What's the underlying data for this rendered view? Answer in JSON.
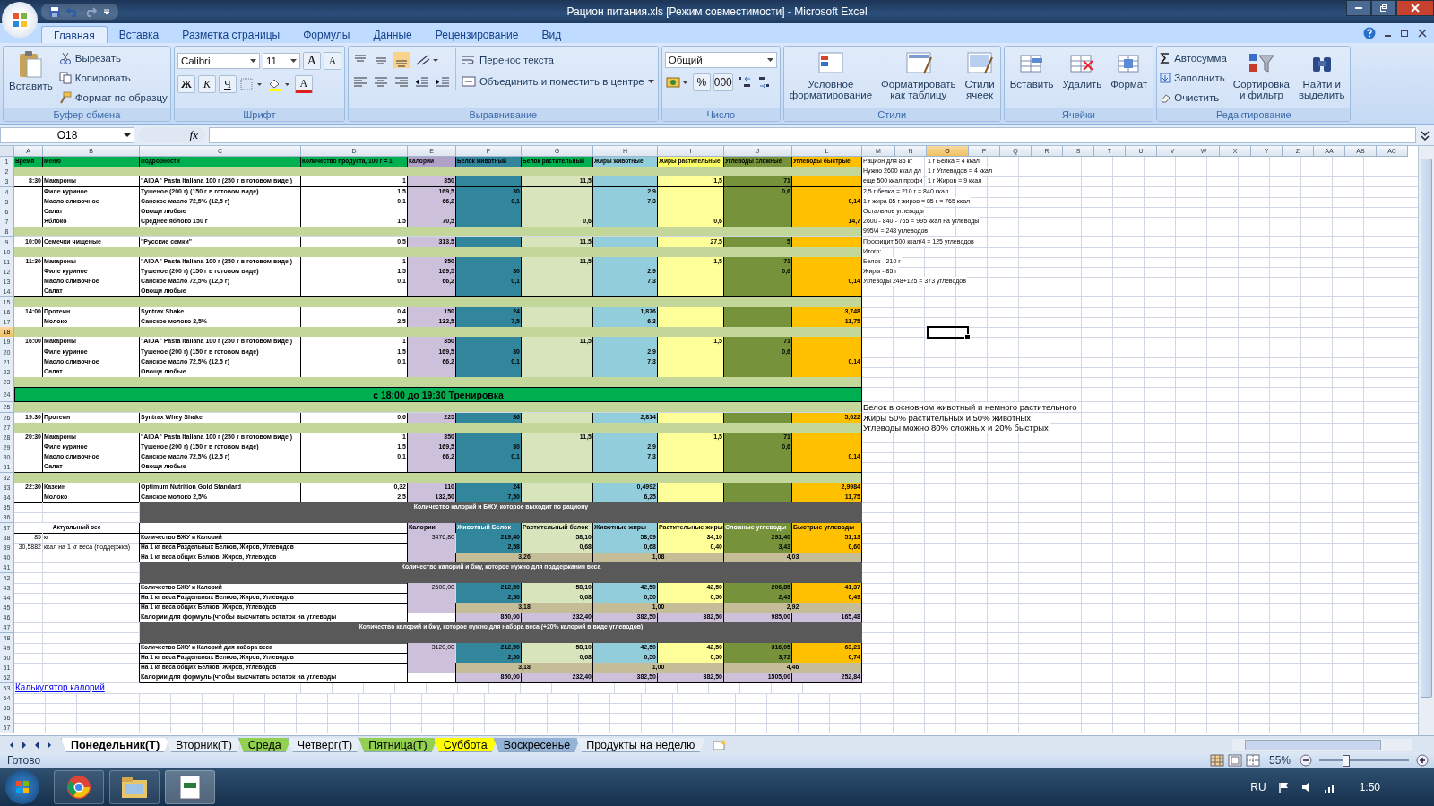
{
  "window": {
    "title": "Рацион питания.xls  [Режим совместимости] - Microsoft Excel"
  },
  "ribbon": {
    "tabs": [
      {
        "label": "Главная",
        "selected": true
      },
      {
        "label": "Вставка",
        "selected": false
      },
      {
        "label": "Разметка страницы",
        "selected": false
      },
      {
        "label": "Формулы",
        "selected": false
      },
      {
        "label": "Данные",
        "selected": false
      },
      {
        "label": "Рецензирование",
        "selected": false
      },
      {
        "label": "Вид",
        "selected": false
      }
    ],
    "clipboard": {
      "paste": "Вставить",
      "cut": "Вырезать",
      "copy": "Копировать",
      "painter": "Формат по образцу",
      "label": "Буфер обмена"
    },
    "font": {
      "family": "Calibri",
      "size": "11",
      "grow": "A",
      "shrink": "A",
      "bold": "Ж",
      "italic": "К",
      "underline": "Ч",
      "tint": "A",
      "label": "Шрифт"
    },
    "alignment": {
      "wrap": "Перенос текста",
      "merge": "Объединить и поместить в центре",
      "label": "Выравнивание"
    },
    "number": {
      "format": "Общий",
      "percent": "%",
      "thousands": "000",
      "label": "Число"
    },
    "styles": {
      "buttons": [
        "Условное\nформатирование",
        "Форматировать\nкак таблицу",
        "Стили\nячеек"
      ],
      "label": "Стили"
    },
    "cells": {
      "buttons": [
        "Вставить",
        "Удалить",
        "Формат"
      ],
      "label": "Ячейки"
    },
    "editing": {
      "autosum": "Автосумма",
      "fill": "Заполнить",
      "clear": "Очистить",
      "sort": "Сортировка\nи фильтр",
      "find": "Найти и\nвыделить",
      "label": "Редактирование"
    }
  },
  "formula_bar": {
    "name_box": "O18",
    "fx": "fx"
  },
  "columns": [
    {
      "label": "A",
      "selected": false
    },
    {
      "label": "B",
      "selected": false
    },
    {
      "label": "C",
      "selected": false
    },
    {
      "label": "D",
      "selected": false
    },
    {
      "label": "E",
      "selected": false
    },
    {
      "label": "F",
      "selected": false
    },
    {
      "label": "G",
      "selected": false
    },
    {
      "label": "H",
      "selected": false
    },
    {
      "label": "I",
      "selected": false
    },
    {
      "label": "J",
      "selected": false
    },
    {
      "label": "L",
      "selected": false
    },
    {
      "label": "M",
      "selected": false
    },
    {
      "label": "N",
      "selected": false
    },
    {
      "label": "O",
      "selected": true
    },
    {
      "label": "P",
      "selected": false
    },
    {
      "label": "Q",
      "selected": false
    },
    {
      "label": "R",
      "selected": false
    },
    {
      "label": "S",
      "selected": false
    },
    {
      "label": "T",
      "selected": false
    },
    {
      "label": "U",
      "selected": false
    },
    {
      "label": "V",
      "selected": false
    },
    {
      "label": "W",
      "selected": false
    },
    {
      "label": "X",
      "selected": false
    },
    {
      "label": "Y",
      "selected": false
    },
    {
      "label": "Z",
      "selected": false
    },
    {
      "label": "AA",
      "selected": false
    },
    {
      "label": "AB",
      "selected": false
    },
    {
      "label": "AC",
      "selected": false
    }
  ],
  "rows": [
    {
      "n": "1",
      "selected": false,
      "kind": "header",
      "cells": [
        "Время",
        "Меню",
        "Подробности",
        "Количество продукта, 100 г = 1",
        "Калории",
        "Белок животный",
        "Белок растительный",
        "Жиры животные",
        "Жиры растительные",
        "Углеводы сложные",
        "Углеводы быстрые"
      ],
      "notes": [
        {
          "kind": "main",
          "text": "Рацион для 85 кг"
        },
        {
          "kind": "side",
          "text": "1 г Белка =  4 ккал"
        }
      ]
    },
    {
      "n": "2",
      "selected": false,
      "kind": "gap",
      "notes": [
        {
          "kind": "main",
          "text": "Нужно 2600 ккал дл"
        },
        {
          "kind": "side",
          "text": "1 г Углеводов = 4 ккал"
        }
      ]
    },
    {
      "n": "3",
      "selected": false,
      "kind": "item",
      "cells": [
        "8:30",
        "Макароны",
        "\"AIDA\" Pasta Italiana 100 г (250 г в готовом виде )",
        "1",
        "350",
        null,
        "11,5",
        null,
        "1,5",
        "71",
        null
      ],
      "notes": [
        {
          "kind": "main",
          "text": "еще 500 ккал профи"
        },
        {
          "kind": "side",
          "text": "1 г Жиров = 9 ккал"
        }
      ]
    },
    {
      "n": "4",
      "selected": false,
      "kind": "item",
      "cells": [
        null,
        "Филе куриное",
        "Тушеное (200 г) (150 г  в готовом виде)",
        "1,5",
        "169,5",
        "30",
        null,
        "2,9",
        null,
        "0,6",
        null
      ],
      "notes": [
        {
          "kind": "main",
          "text": "2,5 г белка = 210 г = 840 ккал"
        }
      ]
    },
    {
      "n": "5",
      "selected": false,
      "kind": "item",
      "cells": [
        null,
        "Масло сливочное",
        "Санское масло 72,5% (12,5 г)",
        "0,1",
        "66,2",
        "0,1",
        null,
        "7,3",
        null,
        null,
        "0,14"
      ],
      "notes": [
        {
          "kind": "main",
          "text": "1 г жира 85 г жиров = 85 г = 765 ккал"
        }
      ]
    },
    {
      "n": "6",
      "selected": false,
      "kind": "item",
      "cells": [
        null,
        "Салат",
        "Овощи любые",
        null,
        null,
        null,
        null,
        null,
        null,
        null,
        null
      ],
      "notes": [
        {
          "kind": "main",
          "text": "Остальное углеводы"
        }
      ]
    },
    {
      "n": "7",
      "selected": false,
      "kind": "item",
      "cells": [
        null,
        "Яблоко",
        "Среднее яблоко 150 г",
        "1,5",
        "70,5",
        null,
        "0,6",
        null,
        "0,6",
        null,
        "14,7"
      ],
      "notes": [
        {
          "kind": "main",
          "text": "2600 - 840 - 765 = 995 ккал на углеводы"
        }
      ]
    },
    {
      "n": "8",
      "selected": false,
      "kind": "gap",
      "notes": [
        {
          "kind": "main",
          "text": "995\\4 = 248 углеводов"
        }
      ]
    },
    {
      "n": "9",
      "selected": false,
      "kind": "item",
      "cells": [
        "10:00",
        "Семечки чищеные",
        "\"Русские семки\"",
        "0,5",
        "313,5",
        null,
        "11,5",
        null,
        "27,5",
        "5",
        null
      ],
      "notes": [
        {
          "kind": "main",
          "text": "Профицит 500 ккал/4 = 125 углеводов"
        }
      ]
    },
    {
      "n": "10",
      "selected": false,
      "kind": "gap",
      "notes": [
        {
          "kind": "main",
          "text": "Итого:"
        }
      ]
    },
    {
      "n": "11",
      "selected": false,
      "kind": "item",
      "cells": [
        "11:30",
        "Макароны",
        "\"AIDA\" Pasta Italiana 100 г (250 г в готовом виде )",
        "1",
        "350",
        null,
        "11,5",
        null,
        "1,5",
        "71",
        null
      ],
      "notes": [
        {
          "kind": "main",
          "text": "Белок - 210 г"
        }
      ]
    },
    {
      "n": "12",
      "selected": false,
      "kind": "item",
      "cells": [
        null,
        "Филе куриное",
        "Тушеное (200 г) (150 г  в готовом виде)",
        "1,5",
        "169,5",
        "30",
        null,
        "2,9",
        null,
        "0,6",
        null
      ],
      "notes": [
        {
          "kind": "main",
          "text": "Жиры - 85 г"
        }
      ]
    },
    {
      "n": "13",
      "selected": false,
      "kind": "item",
      "cells": [
        null,
        "Масло сливочное",
        "Санское масло 72,5% (12,5 г)",
        "0,1",
        "66,2",
        "0,1",
        null,
        "7,3",
        null,
        null,
        "0,14"
      ],
      "notes": [
        {
          "kind": "main",
          "text": "Углеводы 248+125 = 373 углеводов"
        }
      ]
    },
    {
      "n": "14",
      "selected": false,
      "kind": "item",
      "cells": [
        null,
        "Салат",
        "Овощи любые",
        null,
        null,
        null,
        null,
        null,
        null,
        null,
        null
      ]
    },
    {
      "n": "15",
      "selected": false,
      "kind": "gap"
    },
    {
      "n": "16",
      "selected": false,
      "kind": "item",
      "cells": [
        "14:00",
        "Протеин",
        "Syntrax Shake",
        "0,4",
        "150",
        "24",
        null,
        "1,876",
        null,
        null,
        "3,748"
      ]
    },
    {
      "n": "17",
      "selected": false,
      "kind": "item",
      "cells": [
        null,
        "Молоко",
        "Санское молоко 2,5%",
        "2,5",
        "132,5",
        "7,5",
        null,
        "6,3",
        null,
        null,
        "11,75"
      ]
    },
    {
      "n": "18",
      "selected": true,
      "kind": "gap"
    },
    {
      "n": "19",
      "selected": false,
      "kind": "item",
      "cells": [
        "16:00",
        "Макароны",
        "\"AIDA\" Pasta Italiana 100 г (250 г в готовом виде )",
        "1",
        "350",
        null,
        "11,5",
        null,
        "1,5",
        "71",
        null
      ]
    },
    {
      "n": "20",
      "selected": false,
      "kind": "item",
      "cells": [
        null,
        "Филе куриное",
        "Тушеное (200 г) (150 г  в готовом виде)",
        "1,5",
        "169,5",
        "30",
        null,
        "2,9",
        null,
        "0,6",
        null
      ]
    },
    {
      "n": "21",
      "selected": false,
      "kind": "item",
      "cells": [
        null,
        "Масло сливочное",
        "Санское масло 72,5% (12,5 г)",
        "0,1",
        "66,2",
        "0,1",
        null,
        "7,3",
        null,
        null,
        "0,14"
      ]
    },
    {
      "n": "22",
      "selected": false,
      "kind": "item",
      "cells": [
        null,
        "Салат",
        "Овощи любые",
        null,
        null,
        null,
        null,
        null,
        null,
        null,
        null
      ]
    },
    {
      "n": "23",
      "selected": false,
      "kind": "gap"
    },
    {
      "n": "24",
      "selected": false,
      "kind": "banner",
      "text": "с 18:00 до 19:30 Тренировка"
    },
    {
      "n": "25",
      "selected": false,
      "kind": "gap",
      "notes": [
        {
          "kind": "large",
          "text": "Белок в основном животный и немного растительного"
        }
      ]
    },
    {
      "n": "26",
      "selected": false,
      "kind": "item",
      "cells": [
        "19:30",
        "Протеин",
        "Syntrax Whey Shake",
        "0,6",
        "225",
        "36",
        null,
        "2,814",
        null,
        null,
        "5,622"
      ],
      "notes": [
        {
          "kind": "large",
          "text": "Жиры 50% растительных и 50% животных"
        }
      ]
    },
    {
      "n": "27",
      "selected": false,
      "kind": "gap",
      "notes": [
        {
          "kind": "large",
          "text": "Углеводы можно 80% сложных и 20% быстрых"
        }
      ]
    },
    {
      "n": "28",
      "selected": false,
      "kind": "item",
      "cells": [
        "20:30",
        "Макароны",
        "\"AIDA\" Pasta Italiana 100 г (250 г в готовом виде )",
        "1",
        "350",
        null,
        "11,5",
        null,
        "1,5",
        "71",
        null
      ]
    },
    {
      "n": "29",
      "selected": false,
      "kind": "item",
      "cells": [
        null,
        "Филе куриное",
        "Тушеное (200 г) (150 г  в готовом виде)",
        "1,5",
        "169,5",
        "30",
        null,
        "2,9",
        null,
        "0,6",
        null
      ]
    },
    {
      "n": "30",
      "selected": false,
      "kind": "item",
      "cells": [
        null,
        "Масло сливочное",
        "Санское масло 72,5% (12,5 г)",
        "0,1",
        "66,2",
        "0,1",
        null,
        "7,3",
        null,
        null,
        "0,14"
      ]
    },
    {
      "n": "31",
      "selected": false,
      "kind": "item",
      "cells": [
        null,
        "Салат",
        "Овощи любые",
        null,
        null,
        null,
        null,
        null,
        null,
        null,
        null
      ]
    },
    {
      "n": "32",
      "selected": false,
      "kind": "gap"
    },
    {
      "n": "33",
      "selected": false,
      "kind": "item",
      "cells": [
        "22:30",
        "Казеин",
        "Optimum Nutrition Gold Standard",
        "0,32",
        "110",
        "24",
        null,
        "0,4992",
        null,
        null,
        "2,9984"
      ]
    },
    {
      "n": "34",
      "selected": false,
      "kind": "item",
      "cells": [
        null,
        "Молоко",
        "Санское молоко 2,5%",
        "2,5",
        "132,50",
        "7,50",
        null,
        "6,25",
        null,
        null,
        "11,75"
      ]
    },
    {
      "n": "35",
      "selected": false,
      "kind": "band",
      "text": "Количество калорий и БЖУ, которое выходит по рациону"
    },
    {
      "n": "36",
      "selected": false,
      "kind": "band"
    },
    {
      "n": "37",
      "selected": false,
      "kind": "labels",
      "cells": [
        "Актуальный вес",
        null,
        null,
        null,
        "Калории",
        "Животный Белок",
        "Растительный белок",
        "Животные жиры",
        "Растительные жиры",
        "Сложные углеводы",
        "Быстрые углеводы"
      ]
    },
    {
      "n": "38",
      "selected": false,
      "kind": "sum",
      "cells": [
        "85",
        "кг",
        "Количество БЖУ и Калорий",
        null,
        "3476,80",
        "219,40",
        "58,10",
        "58,09",
        "34,10",
        "291,40",
        "51,13"
      ]
    },
    {
      "n": "39",
      "selected": false,
      "kind": "sum",
      "cells": [
        "30,5882",
        "ккал на 1 кг веса (поддержка)",
        "На 1 кг веса Раздельных Белков, Жиров, Углеводов",
        null,
        null,
        "2,58",
        "0,68",
        "0,68",
        "0,40",
        "3,43",
        "0,60"
      ]
    },
    {
      "n": "40",
      "selected": false,
      "kind": "totals",
      "cells": [
        null,
        null,
        "На 1 кг веса общих Белков, Жиров, Углеводов",
        null,
        null,
        "3,26",
        null,
        "1,08",
        null,
        "4,03",
        null
      ]
    },
    {
      "n": "41",
      "selected": false,
      "kind": "band",
      "text": "Количество калорий и бжу, которое нужно для поддержания веса"
    },
    {
      "n": "42",
      "selected": false,
      "kind": "band"
    },
    {
      "n": "43",
      "selected": false,
      "kind": "sum",
      "cells": [
        null,
        null,
        "Количество БЖУ и Калорий",
        null,
        "2600,00",
        "212,50",
        "58,10",
        "42,50",
        "42,50",
        "206,85",
        "41,37"
      ]
    },
    {
      "n": "44",
      "selected": false,
      "kind": "sum",
      "cells": [
        null,
        null,
        "На 1 кг веса Раздельных Белков, Жиров, Углеводов",
        null,
        null,
        "2,50",
        "0,68",
        "0,50",
        "0,50",
        "2,43",
        "0,49"
      ]
    },
    {
      "n": "45",
      "selected": false,
      "kind": "totals",
      "cells": [
        null,
        null,
        "На 1 кг веса общих Белков, Жиров, Углеводов",
        null,
        null,
        "3,18",
        null,
        "1,00",
        null,
        "2,92",
        null
      ]
    },
    {
      "n": "46",
      "selected": false,
      "kind": "calc",
      "cells": [
        null,
        null,
        "Калории для формулы(чтобы высчитать остаток на углеводы",
        null,
        null,
        "850,00",
        "232,40",
        "382,50",
        "382,50",
        "985,00",
        "165,48"
      ]
    },
    {
      "n": "47",
      "selected": false,
      "kind": "band",
      "text": "Количество калорий и бжу, которое нужно для набора веса (+20% калорий в виде углеводов)"
    },
    {
      "n": "48",
      "selected": false,
      "kind": "band"
    },
    {
      "n": "49",
      "selected": false,
      "kind": "sum",
      "cells": [
        null,
        null,
        "Количество БЖУ и Калорий для набора веса",
        null,
        "3120,00",
        "212,50",
        "58,10",
        "42,50",
        "42,50",
        "316,05",
        "63,21"
      ]
    },
    {
      "n": "50",
      "selected": false,
      "kind": "sum",
      "cells": [
        null,
        null,
        "На 1 кг веса Раздельных Белков, Жиров, Углеводов",
        null,
        null,
        "2,50",
        "0,68",
        "0,50",
        "0,50",
        "3,72",
        "0,74"
      ]
    },
    {
      "n": "51",
      "selected": false,
      "kind": "totals",
      "cells": [
        null,
        null,
        "На 1 кг веса общих Белков, Жиров, Углеводов",
        null,
        null,
        "3,18",
        null,
        "1,00",
        null,
        "4,46",
        null
      ]
    },
    {
      "n": "52",
      "selected": false,
      "kind": "calc",
      "cells": [
        null,
        null,
        "Калории для формулы(чтобы высчитать остаток на углеводы",
        null,
        null,
        "850,00",
        "232,40",
        "382,50",
        "382,50",
        "1505,00",
        "252,84"
      ]
    },
    {
      "n": "53",
      "selected": false,
      "kind": "link",
      "text": "Калькулятор калорий"
    },
    {
      "n": "54",
      "selected": false,
      "kind": "empty"
    },
    {
      "n": "55",
      "selected": false,
      "kind": "empty"
    },
    {
      "n": "56",
      "selected": false,
      "kind": "empty"
    },
    {
      "n": "57",
      "selected": false,
      "kind": "empty"
    }
  ],
  "sheet_tabs": [
    {
      "label": "Понедельник(Т)",
      "selected": true
    },
    {
      "label": "Вторник(Т)",
      "selected": false
    },
    {
      "label": "Среда",
      "selected": false,
      "color": "#92d050"
    },
    {
      "label": "Четверг(Т)",
      "selected": false
    },
    {
      "label": "Пятница(Т)",
      "selected": false,
      "color": "#92d050"
    },
    {
      "label": "Суббота",
      "selected": false,
      "color": "#ffff00"
    },
    {
      "label": "Воскресенье",
      "selected": false,
      "color": "#95b3d7"
    },
    {
      "label": "Продукты на неделю",
      "selected": false
    }
  ],
  "status_bar": {
    "text": "Готово",
    "zoom": "55%",
    "level": 0.28
  },
  "taskbar": {
    "language": "RU",
    "time": "1:50"
  }
}
